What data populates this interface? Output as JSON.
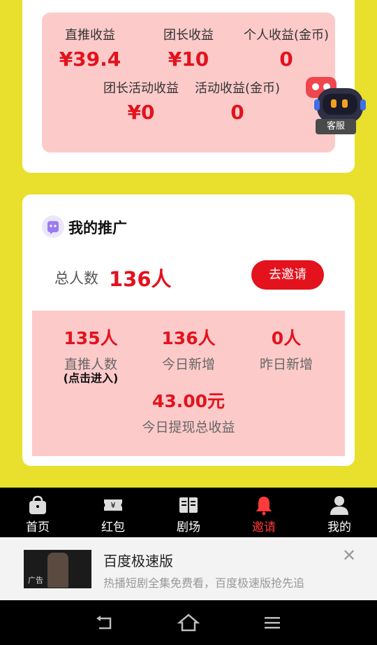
{
  "earnings": {
    "direct": {
      "label": "直推收益",
      "value": "¥39.4"
    },
    "leader": {
      "label": "团长收益",
      "value": "¥10"
    },
    "personal": {
      "label": "个人收益(金币)",
      "value": "0"
    },
    "leader_activity": {
      "label": "团长活动收益",
      "value": "¥0"
    },
    "activity": {
      "label": "活动收益(金币)",
      "value": "0"
    }
  },
  "customer_service": {
    "label": "客服"
  },
  "promotion": {
    "title": "我的推广",
    "total_label": "总人数",
    "total_value": "136人",
    "invite_button": "去邀请",
    "stats": {
      "direct": {
        "value": "135人",
        "label": "直推人数",
        "hint": "(点击进入)"
      },
      "today_new": {
        "value": "136人",
        "label": "今日新增"
      },
      "yesterday_new": {
        "value": "0人",
        "label": "昨日新增"
      },
      "today_withdraw": {
        "value": "43.00元",
        "label": "今日提现总收益"
      }
    }
  },
  "tabbar": {
    "home": "首页",
    "redpacket": "红包",
    "theater": "剧场",
    "invite": "邀请",
    "mine": "我的",
    "active": "invite"
  },
  "ad": {
    "title": "百度极速版",
    "description": "热播短剧全集免费看，百度极速版抢先追",
    "tag": "广告"
  },
  "colors": {
    "background": "#e8e02c",
    "accent": "#e3121d",
    "panel": "#fdcaca",
    "active_tab": "#ff3a3a"
  }
}
